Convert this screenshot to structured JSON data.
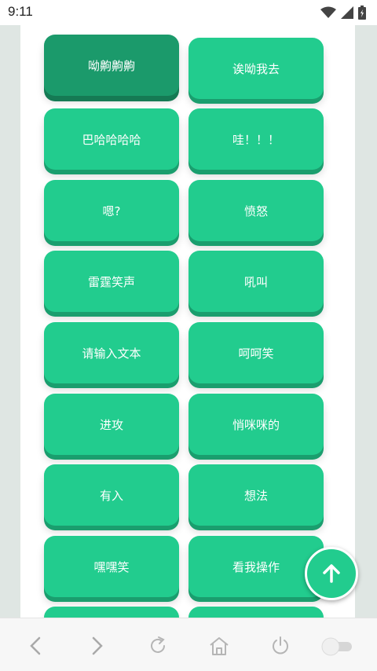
{
  "status_bar": {
    "time": "9:11"
  },
  "buttons": [
    "呦齁齁齁",
    "诶呦我去",
    "巴哈哈哈哈",
    "哇！！！",
    "嗯?",
    "愤怒",
    "雷霆笑声",
    "吼叫",
    "请输入文本",
    "呵呵笑",
    "进攻",
    "悄咪咪的",
    "有入",
    "想法",
    "嘿嘿笑",
    "看我操作"
  ],
  "bottom_nav": {
    "icons": [
      "back-icon",
      "forward-icon",
      "refresh-icon",
      "home-icon",
      "power-icon",
      "toggle-switch"
    ]
  },
  "fab_icon": "arrow-up-icon",
  "colors": {
    "accent": "#22cc8e",
    "accent_shadow": "#1a9e6e",
    "pressed": "#1b9a6b",
    "side": "#dfe6e3"
  }
}
